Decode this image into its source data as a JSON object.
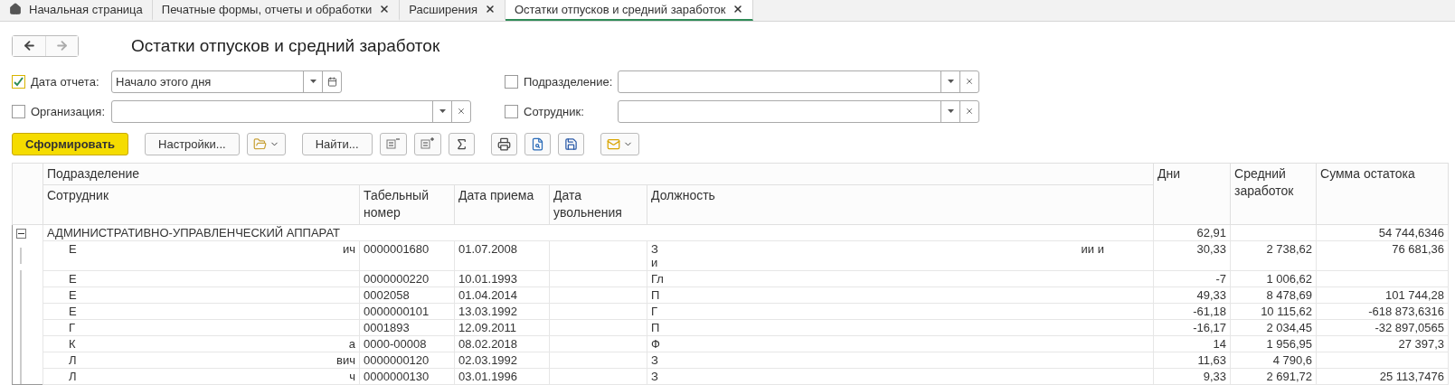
{
  "tabs": [
    {
      "label": "Начальная страница",
      "kind": "home",
      "selected": false
    },
    {
      "label": "Печатные формы, отчеты и обработки",
      "kind": "closable",
      "selected": false
    },
    {
      "label": "Расширения",
      "kind": "closable",
      "selected": false
    },
    {
      "label": "Остатки отпусков и средний заработок",
      "kind": "closable",
      "selected": true
    }
  ],
  "title": "Остатки отпусков и средний заработок",
  "filters": [
    {
      "label": "Дата отчета:",
      "checked": true,
      "value": "Начало этого дня",
      "kind": "date"
    },
    {
      "label": "Подразделение:",
      "checked": false,
      "kind": "select"
    },
    {
      "label": "Организация:",
      "checked": false,
      "kind": "select"
    },
    {
      "label": "Сотрудник:",
      "checked": false,
      "kind": "select"
    }
  ],
  "toolbar": [
    {
      "kind": "primary",
      "label": "Сформировать"
    },
    {
      "kind": "text",
      "label": "Настройки..."
    },
    {
      "kind": "variants"
    },
    {
      "kind": "text",
      "label": "Найти..."
    },
    {
      "kind": "collapse"
    },
    {
      "kind": "expand"
    },
    {
      "kind": "sum"
    },
    {
      "kind": "print"
    },
    {
      "kind": "preview"
    },
    {
      "kind": "save"
    },
    {
      "kind": "mail"
    }
  ],
  "table": {
    "group_header": "Подразделение",
    "columns": [
      "Сотрудник",
      "Табельный номер",
      "Дата приема",
      "Дата увольнения",
      "Должность"
    ],
    "value_columns": [
      "Дни",
      "Средний заработок",
      "Сумма остатока"
    ],
    "group": {
      "name": "АДМИНИСТРАТИВНО-УПРАВЛЕНЧЕСКИЙ АППАРАТ",
      "expanded": true,
      "days": "62,91",
      "sum": "54 744,6346"
    },
    "rows": [
      {
        "employee": "Е",
        "employee_end": "ич",
        "number": "0000001680",
        "hired": "01.07.2008",
        "position": "З",
        "position_line2": "и",
        "position_tail": "ии и",
        "days": "30,33",
        "average": "2 738,62",
        "sum": "76 681,36"
      },
      {
        "employee": "Е",
        "number": "0000000220",
        "hired": "10.01.1993",
        "position": "Гл",
        "days": "-7",
        "average": "1 006,62"
      },
      {
        "employee": "Е",
        "number": "0002058",
        "hired": "01.04.2014",
        "position": "П",
        "days": "49,33",
        "average": "8 478,69",
        "sum": "101 744,28"
      },
      {
        "employee": "Е",
        "number": "0000000101",
        "hired": "13.03.1992",
        "position": "Г",
        "days": "-61,18",
        "average": "10 115,62",
        "sum": "-618 873,6316"
      },
      {
        "employee": "Г",
        "number": "0001893",
        "hired": "12.09.2011",
        "position": "П",
        "days": "-16,17",
        "average": "2 034,45",
        "sum": "-32 897,0565"
      },
      {
        "employee": "К",
        "employee_end": "а",
        "number": "0000-00008",
        "hired": "08.02.2018",
        "position": "Ф",
        "days": "14",
        "average": "1 956,95",
        "sum": "27 397,3"
      },
      {
        "employee": "Л",
        "employee_end": "вич",
        "number": "0000000120",
        "hired": "02.03.1992",
        "position": "З",
        "days": "11,63",
        "average": "4 790,6"
      },
      {
        "employee": "Л",
        "employee_end": "ч",
        "number": "0000000130",
        "hired": "03.01.1996",
        "position": "З",
        "days": "9,33",
        "average": "2 691,72",
        "sum": "25 113,7476"
      }
    ]
  }
}
